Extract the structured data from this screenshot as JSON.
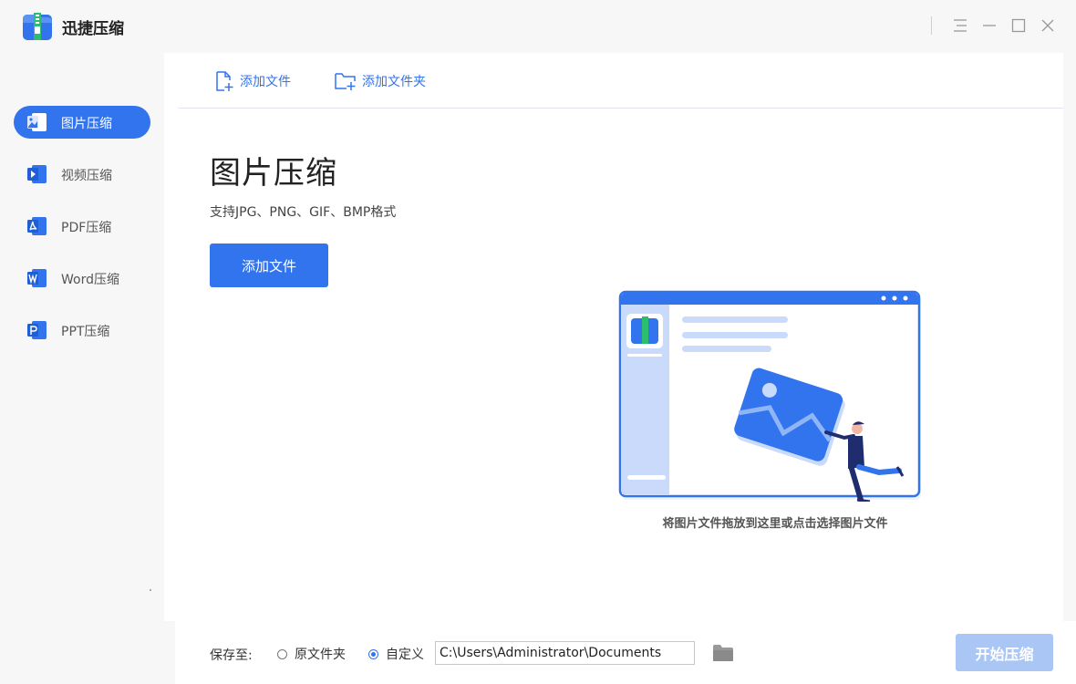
{
  "app": {
    "title": "迅捷压缩",
    "logo_icon": "zip-archive-icon"
  },
  "window_controls": [
    "menu-icon",
    "minimize-icon",
    "maximize-icon",
    "close-icon"
  ],
  "sidebar": {
    "items": [
      {
        "label": "图片压缩",
        "icon": "image-file-icon",
        "active": true
      },
      {
        "label": "视频压缩",
        "icon": "video-file-icon",
        "active": false
      },
      {
        "label": "PDF压缩",
        "icon": "pdf-file-icon",
        "active": false
      },
      {
        "label": "Word压缩",
        "icon": "word-file-icon",
        "active": false
      },
      {
        "label": "PPT压缩",
        "icon": "ppt-file-icon",
        "active": false
      }
    ]
  },
  "toolbar": {
    "add_file_label": "添加文件",
    "add_folder_label": "添加文件夹"
  },
  "main": {
    "title": "图片压缩",
    "subtitle": "支持JPG、PNG、GIF、BMP格式",
    "add_button_label": "添加文件",
    "drop_hint": "将图片文件拖放到这里或点击选择图片文件"
  },
  "bottom": {
    "save_label": "保存至:",
    "options": [
      {
        "label": "原文件夹",
        "checked": false
      },
      {
        "label": "自定义",
        "checked": true
      }
    ],
    "path_value": "C:\\Users\\Administrator\\Documents",
    "start_label": "开始压缩"
  },
  "colors": {
    "accent": "#3274ed",
    "disabled_button": "#a9c6f5",
    "background": "#f7f7f7"
  }
}
